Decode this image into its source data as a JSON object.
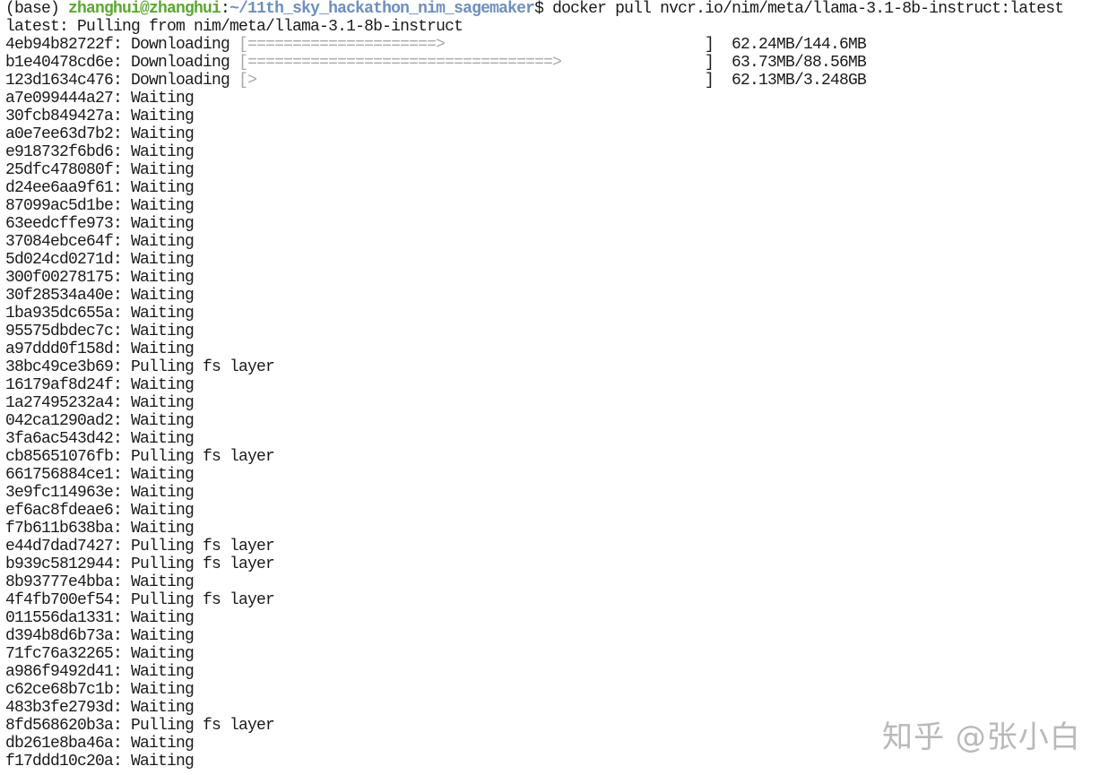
{
  "prompt": {
    "env": "(base) ",
    "user_host": "zhanghui@zhanghui",
    "colon": ":",
    "path": "~/11th_sky_hackathon_nim_sagemaker",
    "command": "$ docker pull nvcr.io/nim/meta/llama-3.1-8b-instruct:latest"
  },
  "status_line": "latest: Pulling from nim/meta/llama-3.1-8b-instruct",
  "downloads": [
    {
      "id": "4eb94b82722f",
      "status": "Downloading",
      "bar": "[=====================>",
      "bar_end": "]",
      "size": "62.24MB/144.6MB",
      "progress": 0.43
    },
    {
      "id": "b1e40478cd6e",
      "status": "Downloading",
      "bar": "[==================================>",
      "bar_end": "]",
      "size": "63.73MB/88.56MB",
      "progress": 0.72
    },
    {
      "id": "123d1634c476",
      "status": "Downloading",
      "bar": "[>",
      "bar_end": "]",
      "size": "62.13MB/3.248GB",
      "progress": 0.02
    }
  ],
  "layers": [
    {
      "id": "a7e099444a27",
      "status": "Waiting"
    },
    {
      "id": "30fcb849427a",
      "status": "Waiting"
    },
    {
      "id": "a0e7ee63d7b2",
      "status": "Waiting"
    },
    {
      "id": "e918732f6bd6",
      "status": "Waiting"
    },
    {
      "id": "25dfc478080f",
      "status": "Waiting"
    },
    {
      "id": "d24ee6aa9f61",
      "status": "Waiting"
    },
    {
      "id": "87099ac5d1be",
      "status": "Waiting"
    },
    {
      "id": "63eedcffe973",
      "status": "Waiting"
    },
    {
      "id": "37084ebce64f",
      "status": "Waiting"
    },
    {
      "id": "5d024cd0271d",
      "status": "Waiting"
    },
    {
      "id": "300f00278175",
      "status": "Waiting"
    },
    {
      "id": "30f28534a40e",
      "status": "Waiting"
    },
    {
      "id": "1ba935dc655a",
      "status": "Waiting"
    },
    {
      "id": "95575dbdec7c",
      "status": "Waiting"
    },
    {
      "id": "a97ddd0f158d",
      "status": "Waiting"
    },
    {
      "id": "38bc49ce3b69",
      "status": "Pulling fs layer"
    },
    {
      "id": "16179af8d24f",
      "status": "Waiting"
    },
    {
      "id": "1a27495232a4",
      "status": "Waiting"
    },
    {
      "id": "042ca1290ad2",
      "status": "Waiting"
    },
    {
      "id": "3fa6ac543d42",
      "status": "Waiting"
    },
    {
      "id": "cb85651076fb",
      "status": "Pulling fs layer"
    },
    {
      "id": "661756884ce1",
      "status": "Waiting"
    },
    {
      "id": "3e9fc114963e",
      "status": "Waiting"
    },
    {
      "id": "ef6ac8fdeae6",
      "status": "Waiting"
    },
    {
      "id": "f7b611b638ba",
      "status": "Waiting"
    },
    {
      "id": "e44d7dad7427",
      "status": "Pulling fs layer"
    },
    {
      "id": "b939c5812944",
      "status": "Pulling fs layer"
    },
    {
      "id": "8b93777e4bba",
      "status": "Waiting"
    },
    {
      "id": "4f4fb700ef54",
      "status": "Pulling fs layer"
    },
    {
      "id": "011556da1331",
      "status": "Waiting"
    },
    {
      "id": "d394b8d6b73a",
      "status": "Waiting"
    },
    {
      "id": "71fc76a32265",
      "status": "Waiting"
    },
    {
      "id": "a986f9492d41",
      "status": "Waiting"
    },
    {
      "id": "c62ce68b7c1b",
      "status": "Waiting"
    },
    {
      "id": "483b3fe2793d",
      "status": "Waiting"
    },
    {
      "id": "8fd568620b3a",
      "status": "Pulling fs layer"
    },
    {
      "id": "db261e8ba46a",
      "status": "Waiting"
    },
    {
      "id": "f17ddd10c20a",
      "status": "Waiting"
    }
  ],
  "watermark": "知乎 @张小白",
  "colors": {
    "user_host": "#5ba82f",
    "path": "#6c8fbf",
    "progress_bar": "#a9a9a9",
    "text": "#1a1a1a",
    "background": "#ffffff"
  }
}
